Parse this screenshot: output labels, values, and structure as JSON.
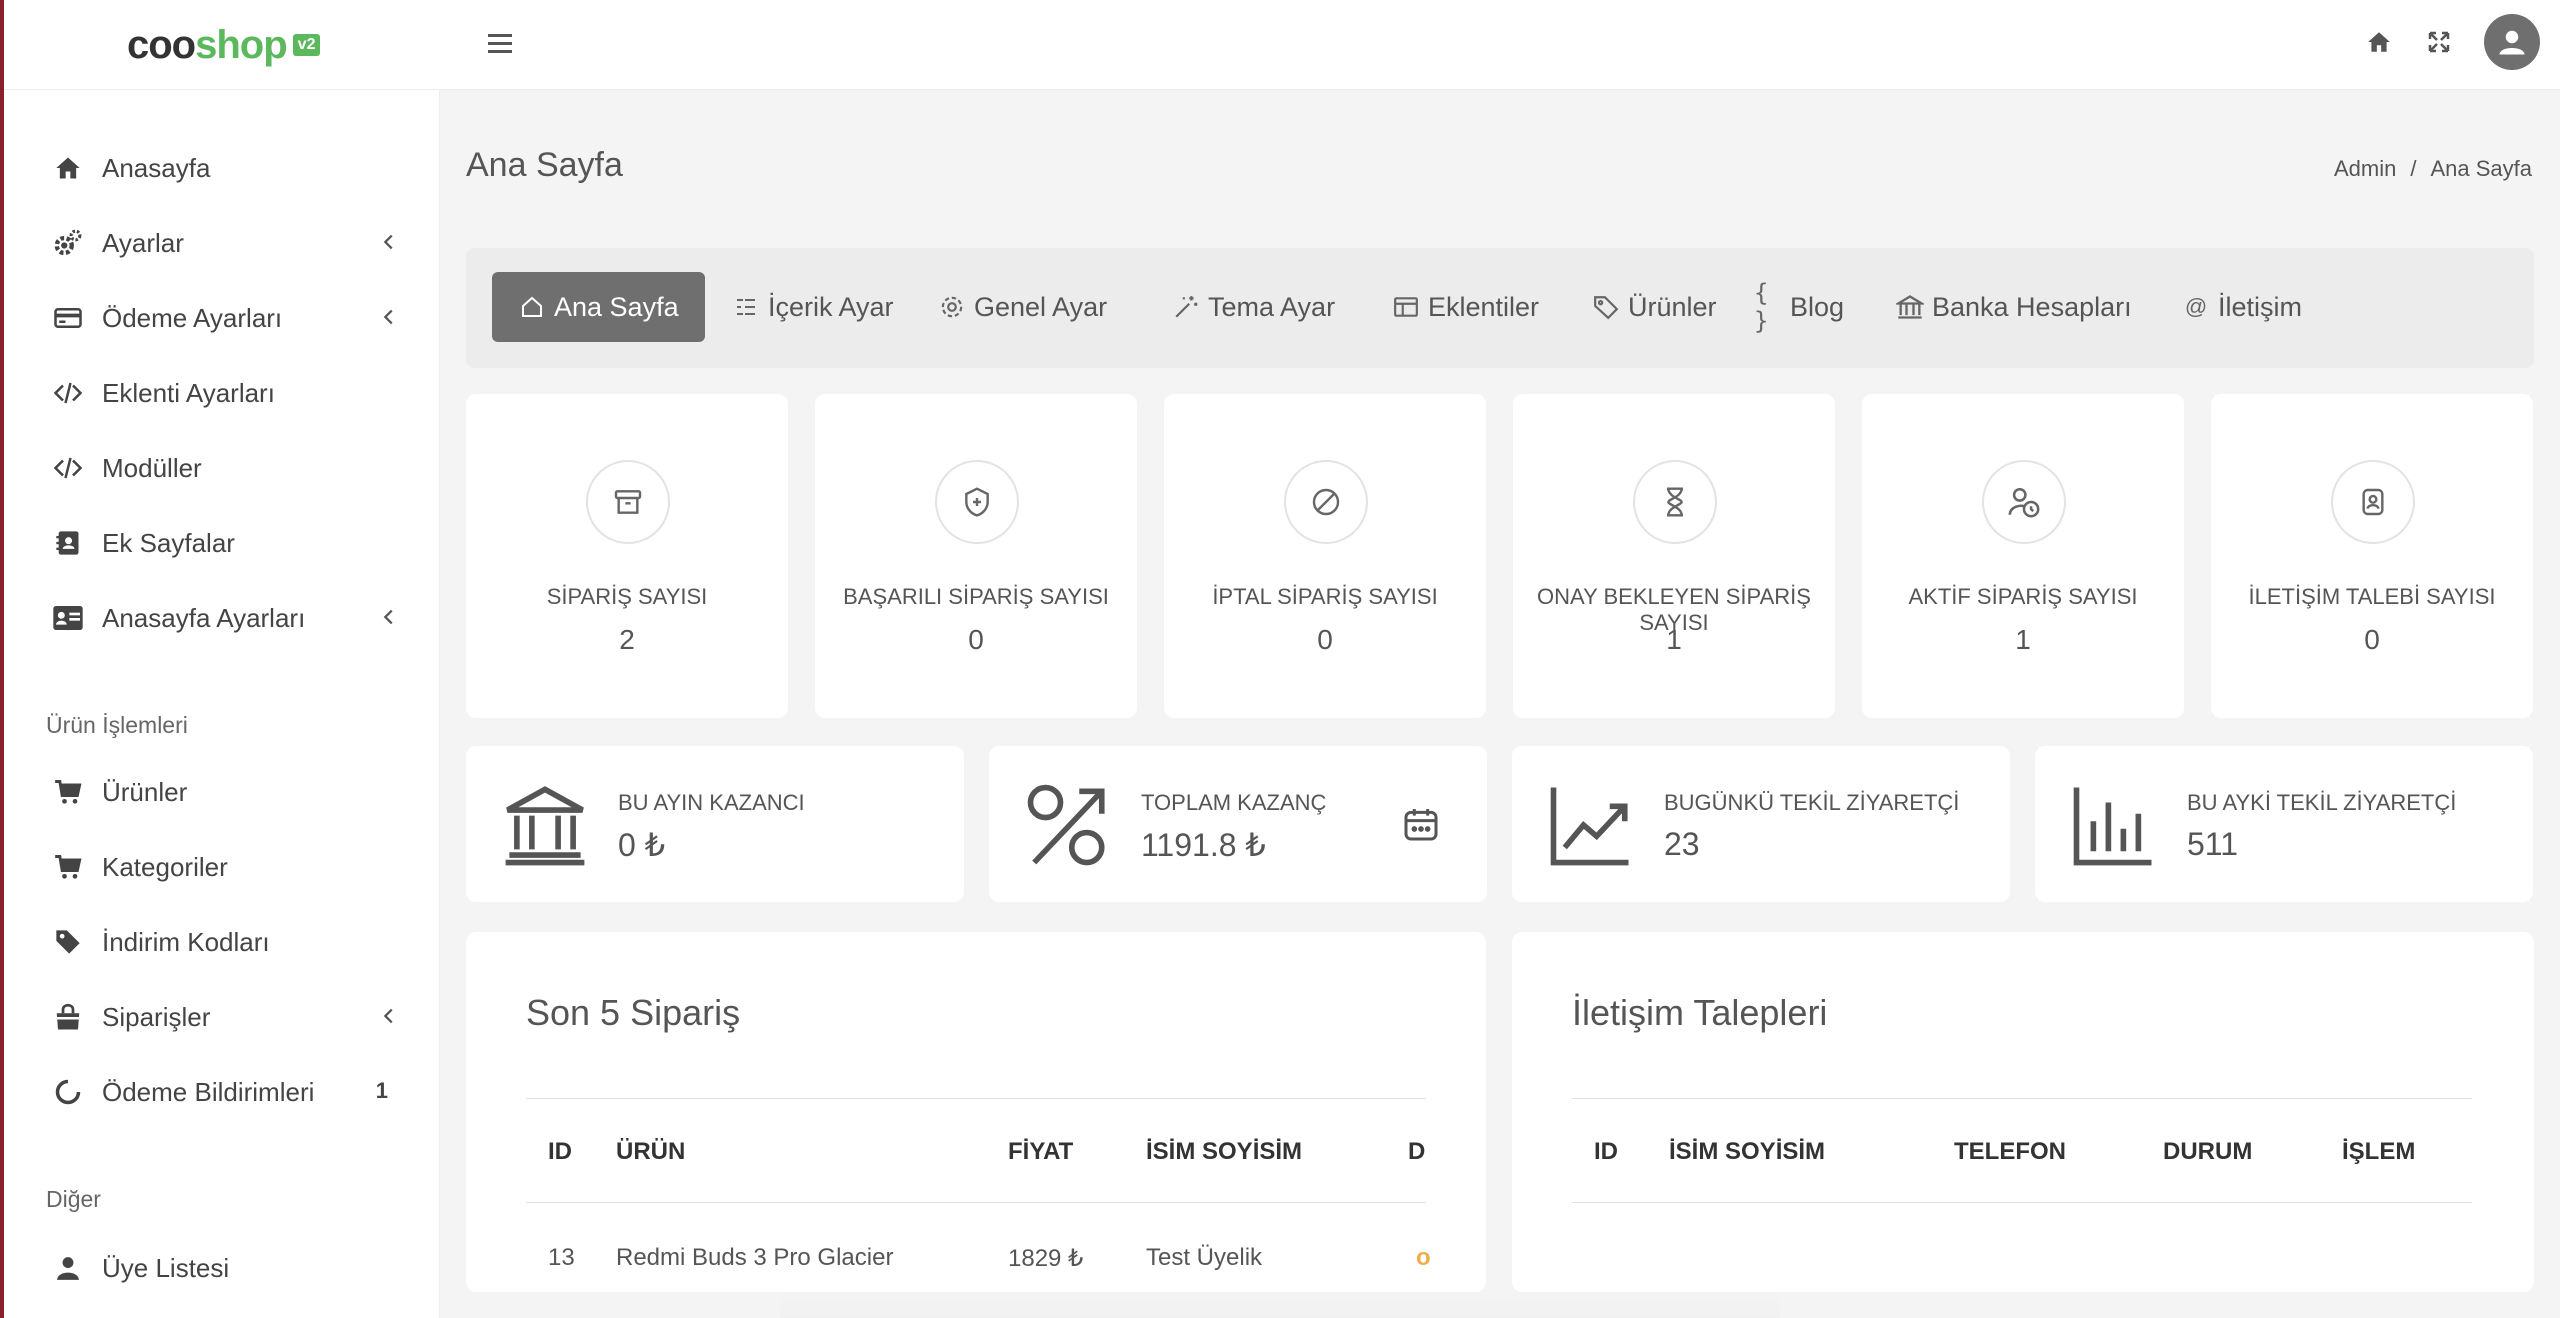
{
  "brand": {
    "part1": "coo",
    "part2": "shop",
    "version": "v2"
  },
  "sidebar": {
    "items": [
      {
        "label": "Anasayfa"
      },
      {
        "label": "Ayarlar"
      },
      {
        "label": "Ödeme Ayarları"
      },
      {
        "label": "Eklenti Ayarları"
      },
      {
        "label": "Modüller"
      },
      {
        "label": "Ek Sayfalar"
      },
      {
        "label": "Anasayfa Ayarları"
      }
    ],
    "section_products": "Ürün İşlemleri",
    "product_items": [
      {
        "label": "Ürünler"
      },
      {
        "label": "Kategoriler"
      },
      {
        "label": "İndirim Kodları"
      },
      {
        "label": "Siparişler"
      },
      {
        "label": "Ödeme Bildirimleri",
        "badge": "1"
      }
    ],
    "section_other": "Diğer",
    "other_items": [
      {
        "label": "Üye Listesi"
      }
    ]
  },
  "page": {
    "title": "Ana Sayfa",
    "breadcrumb": [
      "Admin",
      "/",
      "Ana Sayfa"
    ]
  },
  "tabs": [
    {
      "label": "Ana Sayfa",
      "icon": "house-icon"
    },
    {
      "label": "İçerik Ayar",
      "icon": "list-icon"
    },
    {
      "label": "Genel Ayar",
      "icon": "gear-icon"
    },
    {
      "label": "Tema Ayar",
      "icon": "magic-wand-icon"
    },
    {
      "label": "Eklentiler",
      "icon": "layout-icon"
    },
    {
      "label": "Ürünler",
      "icon": "tag-icon"
    },
    {
      "label": "Blog",
      "icon": "braces-icon"
    },
    {
      "label": "Banka Hesapları",
      "icon": "bank-icon"
    },
    {
      "label": "İletişim",
      "icon": "at-icon"
    }
  ],
  "stats": [
    {
      "label": "SİPARİŞ SAYISI",
      "value": "2",
      "icon": "archive-icon"
    },
    {
      "label": "BAŞARILI SİPARİŞ SAYISI",
      "value": "0",
      "icon": "shield-plus-icon"
    },
    {
      "label": "İPTAL SİPARİŞ SAYISI",
      "value": "0",
      "icon": "ban-icon"
    },
    {
      "label": "ONAY BEKLEYEN SİPARİŞ SAYISI",
      "value": "1",
      "icon": "hourglass-icon"
    },
    {
      "label": "AKTİF SİPARİŞ SAYISI",
      "value": "1",
      "icon": "user-clock-icon"
    },
    {
      "label": "İLETİŞİM TALEBİ SAYISI",
      "value": "0",
      "icon": "file-user-icon"
    }
  ],
  "earnings": [
    {
      "label": "BU AYIN KAZANCI",
      "value": "0 ₺",
      "icon": "bank-icon"
    },
    {
      "label": "TOPLAM KAZANÇ",
      "value": "1191.8 ₺",
      "icon": "percent-icon"
    },
    {
      "label": "BUGÜNKÜ TEKİL ZİYARETÇİ",
      "value": "23",
      "icon": "trend-up-icon"
    },
    {
      "label": "BU AYKİ TEKİL ZİYARETÇİ",
      "value": "511",
      "icon": "bar-chart-icon"
    }
  ],
  "orders": {
    "title": "Son 5 Sipariş",
    "columns": [
      "ID",
      "ÜRÜN",
      "FİYAT",
      "İSİM SOYİSİM",
      "D"
    ],
    "rows": [
      {
        "id": "13",
        "product": "Redmi Buds 3 Pro Glacier",
        "price": "1829 ₺",
        "name": "Test Üyelik",
        "status": "o"
      }
    ]
  },
  "contacts": {
    "title": "İletişim Talepleri",
    "columns": [
      "ID",
      "İSİM SOYİSİM",
      "TELEFON",
      "DURUM",
      "İŞLEM"
    ]
  },
  "colors": {
    "brand_green": "#5cb85c",
    "active_tab": "#6f6f6f",
    "warning": "#f0ad4e"
  }
}
